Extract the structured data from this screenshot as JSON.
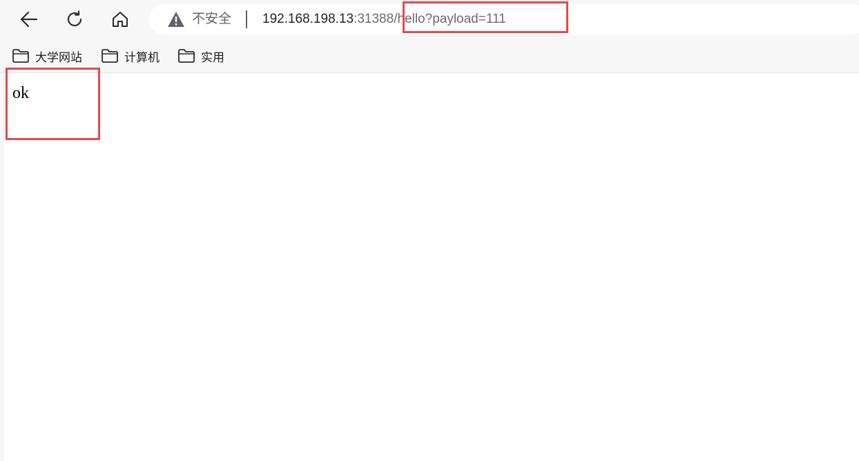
{
  "browser": {
    "security_label": "不安全",
    "url": {
      "host": "192.168.198.13",
      "port_part": ":31388",
      "path_part": "/hello?payload=111"
    },
    "icons": {
      "back": "back-arrow-icon",
      "reload": "reload-icon",
      "home": "home-icon",
      "security": "warning-triangle-icon",
      "bookmark": "folder-icon"
    },
    "bookmarks": [
      {
        "label": "大学网站"
      },
      {
        "label": "计算机"
      },
      {
        "label": "实用"
      }
    ]
  },
  "page": {
    "body_text": "ok"
  },
  "annotations": {
    "highlight_color": "#e8474c"
  }
}
